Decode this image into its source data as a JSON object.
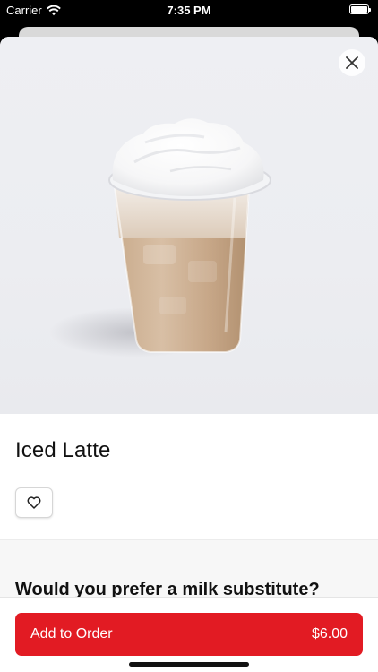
{
  "status_bar": {
    "carrier": "Carrier",
    "time": "7:35 PM",
    "icons": [
      "wifi-icon",
      "battery-icon"
    ]
  },
  "product": {
    "name": "Iced Latte",
    "image": "iced-latte-photo",
    "favorite_icon": "heart-icon",
    "close_icon": "close-icon"
  },
  "options": {
    "question": "Would you prefer a milk substitute?"
  },
  "footer": {
    "cta_label": "Add to Order",
    "price": "$6.00"
  },
  "colors": {
    "accent": "#e21b23",
    "hero_background": "#eceef2",
    "section_background": "#f7f7f7"
  }
}
